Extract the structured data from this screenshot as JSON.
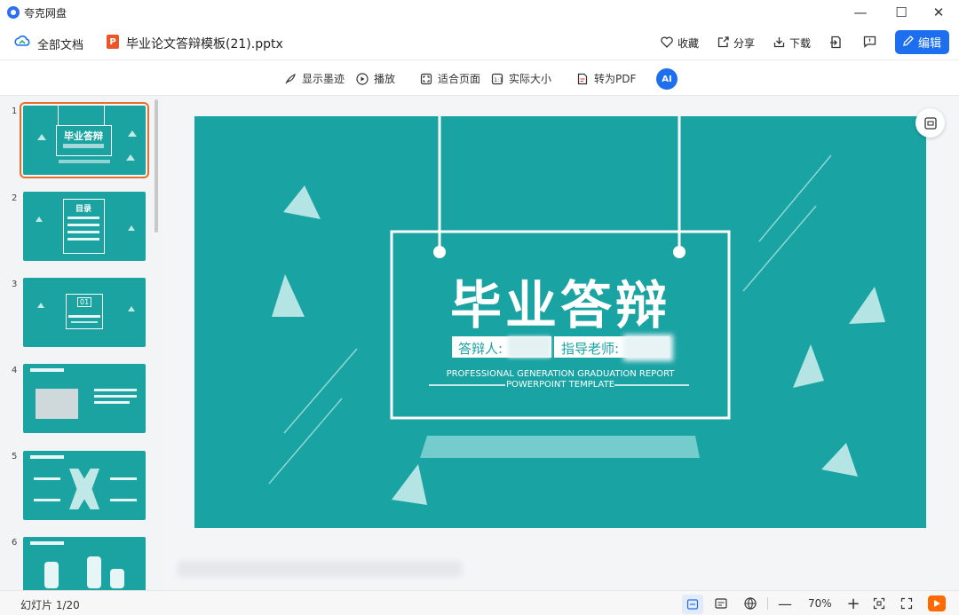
{
  "app": {
    "name": "夸克网盘"
  },
  "window": {
    "minimize": "—",
    "maximize": "☐",
    "close": "✕"
  },
  "header": {
    "breadcrumb": "全部文档",
    "file_name": "毕业论文答辩模板(21).pptx",
    "actions": {
      "favorite": "收藏",
      "share": "分享",
      "download": "下载",
      "edit": "编辑"
    }
  },
  "toolbar": {
    "show_ink": "显示墨迹",
    "play": "播放",
    "fit_page": "适合页面",
    "actual_size": "实际大小",
    "to_pdf": "转为PDF"
  },
  "thumbnails": {
    "items": [
      {
        "num": "1",
        "title": "毕业答辩"
      },
      {
        "num": "2",
        "title": "目录"
      },
      {
        "num": "3",
        "title": "01"
      },
      {
        "num": "4",
        "title": ""
      },
      {
        "num": "5",
        "title": ""
      },
      {
        "num": "6",
        "title": ""
      }
    ]
  },
  "slide": {
    "title": "毕业答辩",
    "defender_label": "答辩人:",
    "advisor_label": "指导老师:",
    "subtitle_line1": "PROFESSIONAL GENERATION GRADUATION REPORT",
    "subtitle_line2": "POWERPOINT TEMPLATE",
    "bg_color": "#1aa3a3",
    "accent_color": "#ffffff"
  },
  "status": {
    "slide_counter": "幻灯片 1/20",
    "zoom": "70%"
  },
  "colors": {
    "brand_blue": "#1e6ff0",
    "selection_orange": "#e76f2c",
    "play_orange": "#ff6a00"
  }
}
